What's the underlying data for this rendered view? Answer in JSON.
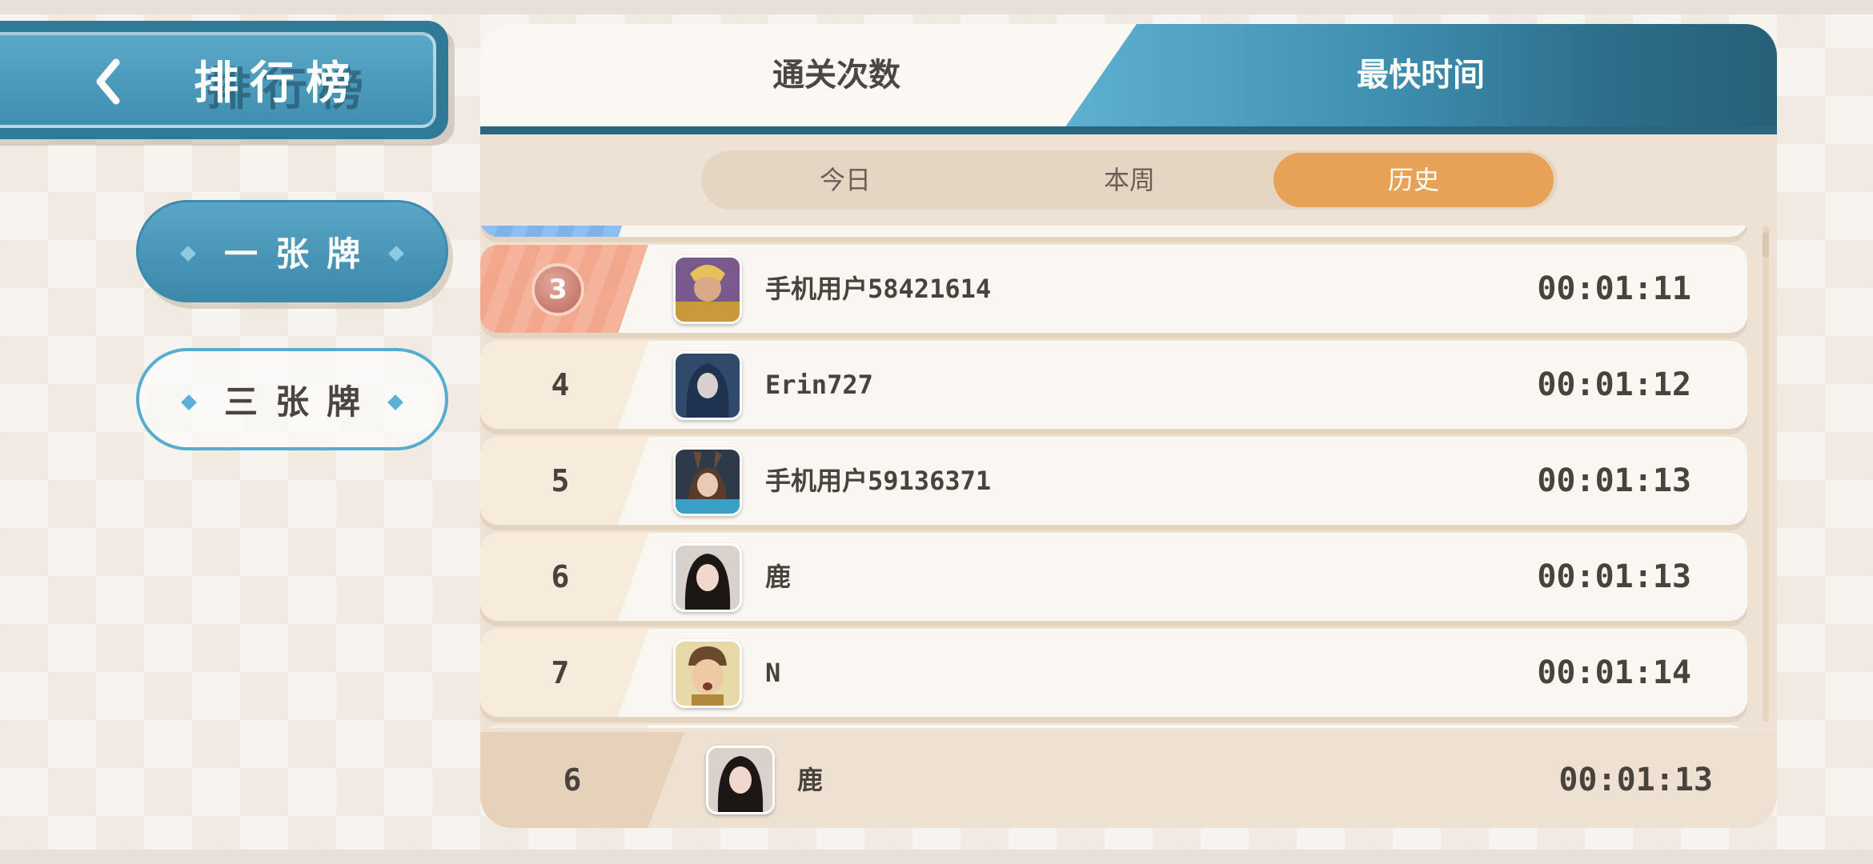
{
  "header": {
    "title": "排行榜",
    "back_icon": "chevron-left-icon"
  },
  "side_menu": {
    "items": [
      {
        "label": "一张牌",
        "active": true
      },
      {
        "label": "三张牌",
        "active": false
      }
    ]
  },
  "tabs": [
    {
      "label": "通关次数",
      "active": false
    },
    {
      "label": "最快时间",
      "active": true
    }
  ],
  "periods": [
    {
      "label": "今日",
      "active": false
    },
    {
      "label": "本周",
      "active": false
    },
    {
      "label": "历史",
      "active": true
    }
  ],
  "leaderboard": {
    "rows": [
      {
        "rank": "3",
        "name": "手机用户58421614",
        "time": "00:01:11"
      },
      {
        "rank": "4",
        "name": "Erin727",
        "time": "00:01:12"
      },
      {
        "rank": "5",
        "name": "手机用户59136371",
        "time": "00:01:13"
      },
      {
        "rank": "6",
        "name": "鹿",
        "time": "00:01:13"
      },
      {
        "rank": "7",
        "name": "N",
        "time": "00:01:14"
      }
    ]
  },
  "my_rank": {
    "rank": "6",
    "name": "鹿",
    "time": "00:01:13"
  },
  "colors": {
    "accent_blue": "#3f8db0",
    "accent_orange": "#e8a258",
    "panel_bg": "#ede2d4",
    "text_dark": "#4a423d"
  }
}
